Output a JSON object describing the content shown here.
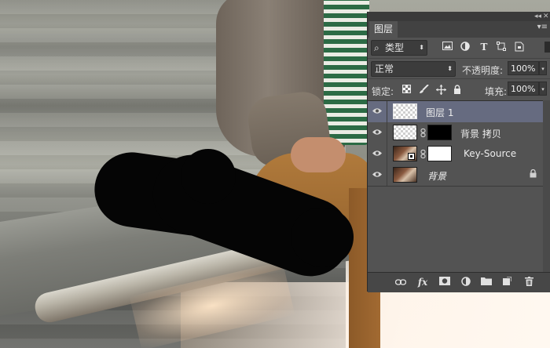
{
  "colors": {
    "panel_bg": "#535353",
    "selected_layer": "#666b80",
    "blob": "#050505"
  },
  "panel": {
    "collapse_glyph": "◂◂",
    "close_glyph": "✕",
    "menu_glyph": "▾≡",
    "tab_label": "图层",
    "filter": {
      "search_glyph": "⌕",
      "kind_label": "类型",
      "arrow_glyph": "⬍",
      "icons": [
        "image-filter-icon",
        "adjustment-filter-icon",
        "type-filter-icon",
        "shape-filter-icon",
        "smart-object-filter-icon"
      ]
    },
    "blend_mode": {
      "value": "正常",
      "arrow_glyph": "⬍"
    },
    "opacity": {
      "label": "不透明度:",
      "value": "100%"
    },
    "lock": {
      "label": "锁定:",
      "icons": [
        "lock-transparent-icon",
        "lock-image-icon",
        "lock-position-icon",
        "lock-all-icon"
      ]
    },
    "fill": {
      "label": "填充:",
      "value": "100%"
    },
    "number_arrow_glyph": "▾",
    "layers": [
      {
        "name": "图层 1",
        "selected": true,
        "thumb": "transparent",
        "visible": true
      },
      {
        "name": "背景 拷贝",
        "selected": false,
        "thumb": "transparent",
        "mask": "black",
        "visible": true
      },
      {
        "name": "Key-Source",
        "selected": false,
        "thumb": "photo",
        "mask": "white",
        "visible": true
      },
      {
        "name": "背景",
        "selected": false,
        "thumb": "photo",
        "locked": true,
        "visible": true
      }
    ],
    "footer_icons": [
      "link-layers-icon",
      "fx-icon",
      "add-mask-icon",
      "adjustment-layer-icon",
      "group-folder-icon",
      "new-layer-icon",
      "trash-icon"
    ]
  }
}
